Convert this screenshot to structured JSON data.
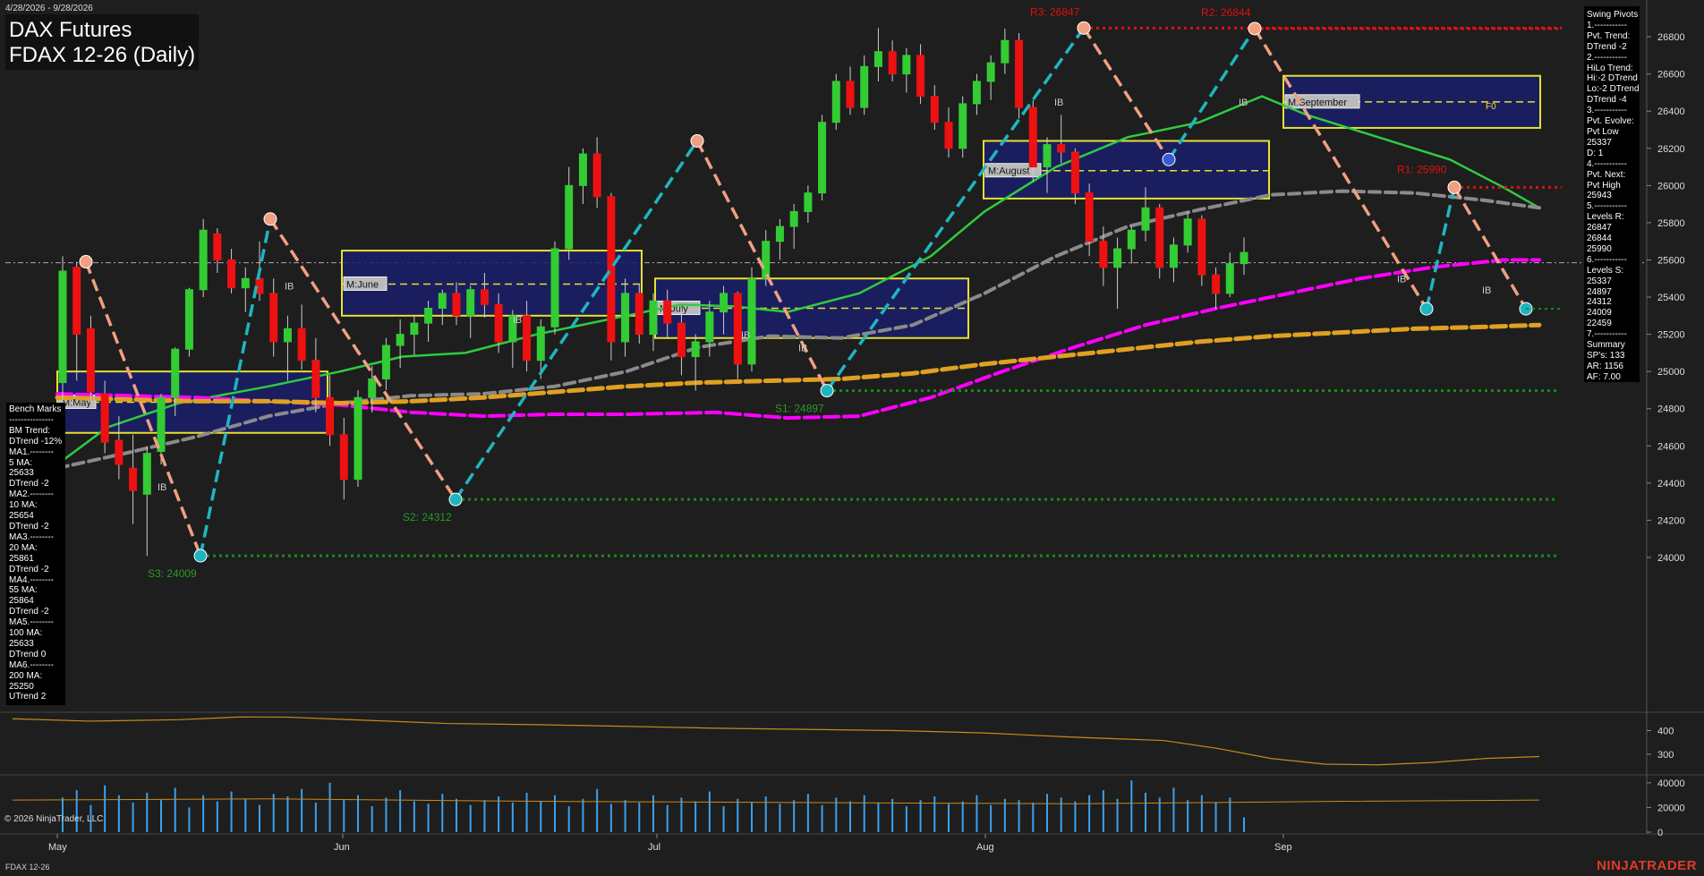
{
  "header": {
    "date_range": "4/28/2026 - 9/28/2026",
    "title_line1": "DAX Futures",
    "title_line2": "FDAX 12-26 (Daily)"
  },
  "benchmarks": {
    "lines": [
      "Bench Marks",
      "---------------",
      "BM Trend:",
      "DTrend -12%",
      "MA1.--------",
      "5 MA:",
      "25633",
      "DTrend -2",
      "MA2.--------",
      "10 MA:",
      "25654",
      "DTrend -2",
      "MA3.--------",
      "20 MA:",
      "25861",
      "DTrend -2",
      "MA4.--------",
      "55 MA:",
      "25864",
      "DTrend -2",
      "MA5.--------",
      "100 MA:",
      "25633",
      "DTrend 0",
      "MA6.--------",
      "200 MA:",
      "25250",
      "UTrend 2"
    ]
  },
  "swing_pivots": {
    "lines": [
      "Swing Pivots",
      "1.-----------",
      "Pvt. Trend:",
      "DTrend -2",
      "2.-----------",
      "HiLo Trend:",
      "Hi:-2 DTrend",
      "Lo:-2 DTrend",
      "DTrend -4",
      "3.-----------",
      "Pvt. Evolve:",
      "Pvt Low",
      "25337",
      "D: 1",
      "4.-----------",
      "Pvt. Next:",
      "Pvt High",
      "25943",
      "5.-----------",
      "Levels R:",
      "26847",
      "26844",
      "25990",
      "6.-----------",
      "Levels S:",
      "25337",
      "24897",
      "24312",
      "24009",
      "22459",
      "7.-----------",
      "Summary",
      "SP's: 133",
      "AR: 1156",
      "AF: 7.00"
    ]
  },
  "footer": {
    "copyright": "© 2026 NinjaTrader, LLC",
    "symbol": "FDAX 12-26",
    "brand": "NINJATRADER"
  },
  "chart_data": {
    "type": "candlestick",
    "title": "FDAX 12-26 (Daily)",
    "x_labels": [
      "May",
      "Jun",
      "Jul",
      "Aug",
      "Sep"
    ],
    "price_axis": {
      "ticks": [
        24000,
        24200,
        24400,
        24600,
        24800,
        25000,
        25200,
        25400,
        25600,
        25800,
        26000,
        26200,
        26400,
        26600,
        26800
      ],
      "ylim": [
        23870,
        26940
      ]
    },
    "current_price_line": 25585,
    "candles": [
      {
        "o": 24940,
        "h": 25620,
        "l": 24720,
        "c": 25540
      },
      {
        "o": 25560,
        "h": 25590,
        "l": 24950,
        "c": 25200
      },
      {
        "o": 25230,
        "h": 25300,
        "l": 24820,
        "c": 24890
      },
      {
        "o": 24880,
        "h": 24950,
        "l": 24560,
        "c": 24620
      },
      {
        "o": 24630,
        "h": 24760,
        "l": 24420,
        "c": 24500
      },
      {
        "o": 24480,
        "h": 24660,
        "l": 24180,
        "c": 24360
      },
      {
        "o": 24340,
        "h": 24600,
        "l": 24009,
        "c": 24560
      },
      {
        "o": 24570,
        "h": 24880,
        "l": 24500,
        "c": 24860
      },
      {
        "o": 24860,
        "h": 25130,
        "l": 24760,
        "c": 25120
      },
      {
        "o": 25120,
        "h": 25450,
        "l": 25080,
        "c": 25440
      },
      {
        "o": 25440,
        "h": 25820,
        "l": 25400,
        "c": 25760
      },
      {
        "o": 25740,
        "h": 25770,
        "l": 25530,
        "c": 25600
      },
      {
        "o": 25600,
        "h": 25660,
        "l": 25420,
        "c": 25450
      },
      {
        "o": 25450,
        "h": 25560,
        "l": 25320,
        "c": 25500
      },
      {
        "o": 25500,
        "h": 25700,
        "l": 25380,
        "c": 25420
      },
      {
        "o": 25420,
        "h": 25500,
        "l": 25080,
        "c": 25160
      },
      {
        "o": 25160,
        "h": 25300,
        "l": 24950,
        "c": 25230
      },
      {
        "o": 25230,
        "h": 25360,
        "l": 25010,
        "c": 25060
      },
      {
        "o": 25060,
        "h": 25180,
        "l": 24780,
        "c": 24860
      },
      {
        "o": 24860,
        "h": 24980,
        "l": 24600,
        "c": 24660
      },
      {
        "o": 24660,
        "h": 24750,
        "l": 24312,
        "c": 24420
      },
      {
        "o": 24420,
        "h": 24900,
        "l": 24380,
        "c": 24860
      },
      {
        "o": 24860,
        "h": 25030,
        "l": 24780,
        "c": 24960
      },
      {
        "o": 24960,
        "h": 25180,
        "l": 24900,
        "c": 25140
      },
      {
        "o": 25140,
        "h": 25280,
        "l": 25020,
        "c": 25200
      },
      {
        "o": 25200,
        "h": 25300,
        "l": 25090,
        "c": 25260
      },
      {
        "o": 25260,
        "h": 25380,
        "l": 25160,
        "c": 25340
      },
      {
        "o": 25340,
        "h": 25440,
        "l": 25250,
        "c": 25420
      },
      {
        "o": 25420,
        "h": 25480,
        "l": 25250,
        "c": 25300
      },
      {
        "o": 25300,
        "h": 25460,
        "l": 25180,
        "c": 25440
      },
      {
        "o": 25440,
        "h": 25530,
        "l": 25290,
        "c": 25360
      },
      {
        "o": 25360,
        "h": 25420,
        "l": 25100,
        "c": 25160
      },
      {
        "o": 25160,
        "h": 25330,
        "l": 25020,
        "c": 25300
      },
      {
        "o": 25300,
        "h": 25380,
        "l": 25000,
        "c": 25060
      },
      {
        "o": 25060,
        "h": 25280,
        "l": 24960,
        "c": 25240
      },
      {
        "o": 25240,
        "h": 25700,
        "l": 25200,
        "c": 25660
      },
      {
        "o": 25660,
        "h": 26100,
        "l": 25600,
        "c": 26000
      },
      {
        "o": 26000,
        "h": 26200,
        "l": 25900,
        "c": 26170
      },
      {
        "o": 26170,
        "h": 26260,
        "l": 25880,
        "c": 25940
      },
      {
        "o": 25940,
        "h": 25960,
        "l": 25060,
        "c": 25160
      },
      {
        "o": 25160,
        "h": 25500,
        "l": 25080,
        "c": 25420
      },
      {
        "o": 25420,
        "h": 25470,
        "l": 25150,
        "c": 25200
      },
      {
        "o": 25200,
        "h": 25420,
        "l": 25110,
        "c": 25380
      },
      {
        "o": 25380,
        "h": 25440,
        "l": 25180,
        "c": 25260
      },
      {
        "o": 25260,
        "h": 25340,
        "l": 24980,
        "c": 25080
      },
      {
        "o": 25080,
        "h": 25200,
        "l": 24897,
        "c": 25160
      },
      {
        "o": 25160,
        "h": 25380,
        "l": 25080,
        "c": 25320
      },
      {
        "o": 25320,
        "h": 25460,
        "l": 25200,
        "c": 25420
      },
      {
        "o": 25420,
        "h": 25430,
        "l": 24960,
        "c": 25040
      },
      {
        "o": 25040,
        "h": 25560,
        "l": 25000,
        "c": 25500
      },
      {
        "o": 25500,
        "h": 25760,
        "l": 25460,
        "c": 25700
      },
      {
        "o": 25700,
        "h": 25820,
        "l": 25600,
        "c": 25780
      },
      {
        "o": 25780,
        "h": 25900,
        "l": 25660,
        "c": 25860
      },
      {
        "o": 25860,
        "h": 26000,
        "l": 25800,
        "c": 25960
      },
      {
        "o": 25960,
        "h": 26380,
        "l": 25920,
        "c": 26340
      },
      {
        "o": 26340,
        "h": 26600,
        "l": 26300,
        "c": 26560
      },
      {
        "o": 26560,
        "h": 26640,
        "l": 26380,
        "c": 26420
      },
      {
        "o": 26420,
        "h": 26700,
        "l": 26380,
        "c": 26640
      },
      {
        "o": 26640,
        "h": 26847,
        "l": 26560,
        "c": 26720
      },
      {
        "o": 26720,
        "h": 26780,
        "l": 26560,
        "c": 26600
      },
      {
        "o": 26600,
        "h": 26740,
        "l": 26500,
        "c": 26700
      },
      {
        "o": 26700,
        "h": 26760,
        "l": 26440,
        "c": 26480
      },
      {
        "o": 26480,
        "h": 26540,
        "l": 26300,
        "c": 26340
      },
      {
        "o": 26340,
        "h": 26420,
        "l": 26150,
        "c": 26200
      },
      {
        "o": 26200,
        "h": 26480,
        "l": 26150,
        "c": 26440
      },
      {
        "o": 26440,
        "h": 26600,
        "l": 26380,
        "c": 26560
      },
      {
        "o": 26560,
        "h": 26700,
        "l": 26460,
        "c": 26660
      },
      {
        "o": 26660,
        "h": 26844,
        "l": 26600,
        "c": 26780
      },
      {
        "o": 26780,
        "h": 26820,
        "l": 26360,
        "c": 26420
      },
      {
        "o": 26420,
        "h": 26460,
        "l": 26020,
        "c": 26100
      },
      {
        "o": 26100,
        "h": 26260,
        "l": 25960,
        "c": 26220
      },
      {
        "o": 26220,
        "h": 26380,
        "l": 26120,
        "c": 26180
      },
      {
        "o": 26180,
        "h": 26200,
        "l": 25900,
        "c": 25960
      },
      {
        "o": 25960,
        "h": 26010,
        "l": 25620,
        "c": 25700
      },
      {
        "o": 25700,
        "h": 25780,
        "l": 25460,
        "c": 25560
      },
      {
        "o": 25560,
        "h": 25720,
        "l": 25337,
        "c": 25660
      },
      {
        "o": 25660,
        "h": 25780,
        "l": 25580,
        "c": 25760
      },
      {
        "o": 25760,
        "h": 25990,
        "l": 25700,
        "c": 25880
      },
      {
        "o": 25880,
        "h": 25900,
        "l": 25500,
        "c": 25560
      },
      {
        "o": 25560,
        "h": 25720,
        "l": 25480,
        "c": 25680
      },
      {
        "o": 25680,
        "h": 25860,
        "l": 25640,
        "c": 25820
      },
      {
        "o": 25820,
        "h": 25840,
        "l": 25460,
        "c": 25520
      },
      {
        "o": 25520,
        "h": 25560,
        "l": 25337,
        "c": 25420
      },
      {
        "o": 25420,
        "h": 25640,
        "l": 25400,
        "c": 25580
      },
      {
        "o": 25580,
        "h": 25720,
        "l": 25520,
        "c": 25640
      }
    ],
    "swing_highs": [
      {
        "label": "R3: 26847",
        "value": 26847
      },
      {
        "label": "R2: 26844",
        "value": 26844
      },
      {
        "label": "R1: 25990",
        "value": 25990
      }
    ],
    "swing_lows": [
      {
        "label": "S1: 24897",
        "value": 24897
      },
      {
        "label": "S2: 24312",
        "value": 24312
      },
      {
        "label": "S3: 24009",
        "value": 24009
      }
    ],
    "monthly_boxes": [
      {
        "label": "M:May",
        "high": 25000,
        "low": 24670,
        "mid": 24835
      },
      {
        "label": "M:June",
        "high": 25650,
        "low": 25300,
        "mid": 25470
      },
      {
        "label": "M:July",
        "high": 25500,
        "low": 25180,
        "mid": 25340
      },
      {
        "label": "M:August",
        "high": 26240,
        "low": 25930,
        "mid": 26080
      },
      {
        "label": "M:September",
        "high": 26590,
        "low": 26310,
        "mid": 26450,
        "tag": "F0"
      }
    ],
    "ib_label": "IB",
    "moving_averages": [
      {
        "name": "20 MA",
        "color": "#2ecc40",
        "value": 25861
      },
      {
        "name": "55 MA",
        "color": "#888888",
        "value": 25864
      },
      {
        "name": "100 MA",
        "color": "#ff00ff",
        "value": 25633
      },
      {
        "name": "200 MA",
        "color": "#e0a020",
        "value": 25250
      }
    ],
    "oscillator_panel": {
      "ticks": [
        300,
        400
      ],
      "ylim": [
        220,
        470
      ]
    },
    "volume_panel": {
      "ticks": [
        0,
        20000,
        40000
      ],
      "ylim": [
        0,
        45000
      ]
    }
  },
  "colors": {
    "background": "#1e1e1e",
    "up": "#33cc33",
    "down": "#ee1111",
    "swing_up": "#1fb5c0",
    "swing_down": "#f0a080",
    "resistance": "#e01010",
    "support": "#1a8a1a"
  }
}
